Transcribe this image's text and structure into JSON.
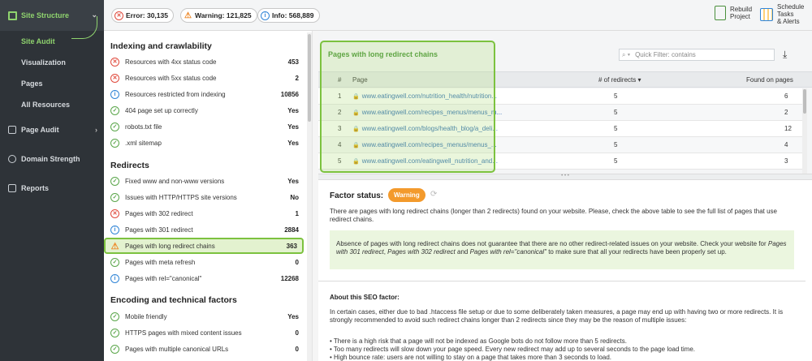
{
  "sidebar": {
    "header": "Site Structure",
    "subitems": [
      "Site Audit",
      "Visualization",
      "Pages",
      "All Resources"
    ],
    "main": [
      "Page Audit",
      "Domain Strength",
      "Reports"
    ]
  },
  "topbar": {
    "error": "Error: 30,135",
    "warning": "Warning: 121,825",
    "info": "Info: 568,889",
    "rebuild": [
      "Rebuild",
      "Project"
    ],
    "schedule": [
      "Schedule",
      "Tasks",
      "& Alerts"
    ]
  },
  "factors": {
    "sections": [
      "Indexing and crawlability",
      "Redirects",
      "Encoding and technical factors"
    ],
    "indexing": [
      {
        "status": "err",
        "label": "Resources with 4xx status code",
        "value": "453"
      },
      {
        "status": "err",
        "label": "Resources with 5xx status code",
        "value": "2"
      },
      {
        "status": "info",
        "label": "Resources restricted from indexing",
        "value": "10856"
      },
      {
        "status": "ok",
        "label": "404 page set up correctly",
        "value": "Yes"
      },
      {
        "status": "ok",
        "label": "robots.txt file",
        "value": "Yes"
      },
      {
        "status": "ok",
        "label": ".xml sitemap",
        "value": "Yes"
      }
    ],
    "redirects": [
      {
        "status": "ok",
        "label": "Fixed www and non-www versions",
        "value": "Yes"
      },
      {
        "status": "ok",
        "label": "Issues with HTTP/HTTPS site versions",
        "value": "No"
      },
      {
        "status": "err",
        "label": "Pages with 302 redirect",
        "value": "1"
      },
      {
        "status": "info",
        "label": "Pages with 301 redirect",
        "value": "2884"
      },
      {
        "status": "warn",
        "label": "Pages with long redirect chains",
        "value": "363"
      },
      {
        "status": "ok",
        "label": "Pages with meta refresh",
        "value": "0"
      },
      {
        "status": "info",
        "label": "Pages with rel=\"canonical\"",
        "value": "12268"
      }
    ],
    "encoding": [
      {
        "status": "ok",
        "label": "Mobile friendly",
        "value": "Yes"
      },
      {
        "status": "ok",
        "label": "HTTPS pages with mixed content issues",
        "value": "0"
      },
      {
        "status": "ok",
        "label": "Pages with multiple canonical URLs",
        "value": "0"
      }
    ]
  },
  "table": {
    "title": "Pages with long redirect chains",
    "filter_placeholder": "Quick Filter: contains",
    "columns": [
      "#",
      "Page",
      "# of redirects ▾",
      "Found on pages"
    ],
    "rows": [
      {
        "n": "1",
        "page": "www.eatingwell.com/nutrition_health/nutrition...",
        "redirects": "5",
        "found": "6"
      },
      {
        "n": "2",
        "page": "www.eatingwell.com/recipes_menus/menus_m...",
        "redirects": "5",
        "found": "2"
      },
      {
        "n": "3",
        "page": "www.eatingwell.com/blogs/health_blog/a_deli...",
        "redirects": "5",
        "found": "12"
      },
      {
        "n": "4",
        "page": "www.eatingwell.com/recipes_menus/menus_...",
        "redirects": "5",
        "found": "4"
      },
      {
        "n": "5",
        "page": "www.eatingwell.com/eatingwell_nutrition_and...",
        "redirects": "5",
        "found": "3"
      }
    ]
  },
  "status": {
    "title": "Factor status:",
    "badge": "Warning",
    "desc": "There are pages with long redirect chains (longer than 2 redirects) found on your website. Please, check the above table to see the full list of pages that use redirect chains.",
    "note_a": "Absence of pages with long redirect chains does not guarantee that there are no other redirect-related issues on your website. Check your website for ",
    "note_i1": "Pages with 301 redirect",
    "note_b": ", ",
    "note_i2": "Pages with 302 redirect",
    "note_c": " and ",
    "note_i3": "Pages with rel=\"canonical\"",
    "note_d": " to make sure that all your redirects have been properly set up.",
    "about_title": "About this SEO factor:",
    "about_p": "In certain cases, either due to bad .htaccess file setup or due to some deliberately taken measures, a page may end up with having two or more redirects. It is strongly recommended to avoid such redirect chains longer than 2 redirects since they may be the reason of multiple issues:",
    "bullets": [
      "• There is a high risk that a page will not be indexed as Google bots do not follow more than 5 redirects.",
      "• Too many redirects will slow down your page speed. Every new redirect may add up to several seconds to the page load time.",
      "• High bounce rate: users are not willing to stay on a page that takes more than 3 seconds to load."
    ]
  }
}
